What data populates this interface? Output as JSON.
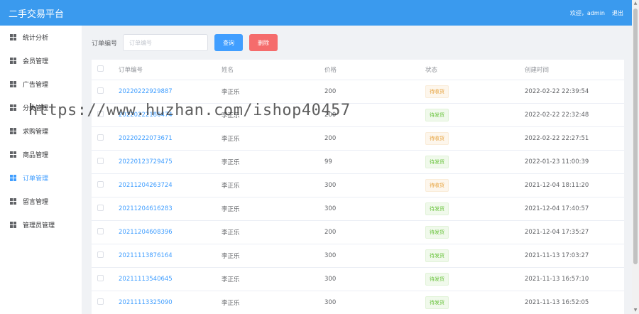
{
  "app": {
    "title": "二手交易平台"
  },
  "header": {
    "welcome": "欢迎，admin",
    "logout": "退出"
  },
  "sidebar": {
    "items": [
      {
        "label": "统计分析",
        "active": false
      },
      {
        "label": "会员管理",
        "active": false
      },
      {
        "label": "广告管理",
        "active": false
      },
      {
        "label": "分类管理",
        "active": false
      },
      {
        "label": "求购管理",
        "active": false
      },
      {
        "label": "商品管理",
        "active": false
      },
      {
        "label": "订单管理",
        "active": true
      },
      {
        "label": "留言管理",
        "active": false
      },
      {
        "label": "管理员管理",
        "active": false
      }
    ]
  },
  "search": {
    "label": "订单编号",
    "value": "",
    "placeholder": "订单编号",
    "query_button": "查询",
    "delete_button": "删除"
  },
  "table": {
    "columns": [
      "订单编号",
      "姓名",
      "价格",
      "状态",
      "创建时间"
    ],
    "rows": [
      {
        "order_no": "20220222929887",
        "name": "李正乐",
        "price": "200",
        "status": "待收货",
        "status_type": "warn",
        "created": "2022-02-22 22:39:54"
      },
      {
        "order_no": "20220222186474",
        "name": "李正乐",
        "price": "200",
        "status": "待发货",
        "status_type": "ok",
        "created": "2022-02-22 22:32:48"
      },
      {
        "order_no": "20220222073671",
        "name": "李正乐",
        "price": "200",
        "status": "待收货",
        "status_type": "warn",
        "created": "2022-02-22 22:27:51"
      },
      {
        "order_no": "20220123729475",
        "name": "李正乐",
        "price": "99",
        "status": "待发货",
        "status_type": "ok",
        "created": "2022-01-23 11:00:39"
      },
      {
        "order_no": "20211204263724",
        "name": "李正乐",
        "price": "300",
        "status": "待收货",
        "status_type": "warn",
        "created": "2021-12-04 18:11:20"
      },
      {
        "order_no": "20211204616283",
        "name": "李正乐",
        "price": "300",
        "status": "待发货",
        "status_type": "ok",
        "created": "2021-12-04 17:40:57"
      },
      {
        "order_no": "20211204608396",
        "name": "李正乐",
        "price": "200",
        "status": "待发货",
        "status_type": "ok",
        "created": "2021-12-04 17:35:27"
      },
      {
        "order_no": "20211113876164",
        "name": "李正乐",
        "price": "300",
        "status": "待发货",
        "status_type": "ok",
        "created": "2021-11-13 17:03:27"
      },
      {
        "order_no": "20211113540645",
        "name": "李正乐",
        "price": "300",
        "status": "待发货",
        "status_type": "ok",
        "created": "2021-11-13 16:57:10"
      },
      {
        "order_no": "20211113325090",
        "name": "李正乐",
        "price": "300",
        "status": "待发货",
        "status_type": "ok",
        "created": "2021-11-13 16:52:05"
      }
    ]
  },
  "watermark": {
    "text": "https://www.huzhan.com/ishop40457"
  },
  "colors": {
    "header": "#3a9aee",
    "primary": "#409eff",
    "danger": "#f56c6c",
    "warning": "#e6a23c",
    "success": "#67c23a"
  },
  "icons": {
    "sidebar_item": "grid-icon"
  }
}
